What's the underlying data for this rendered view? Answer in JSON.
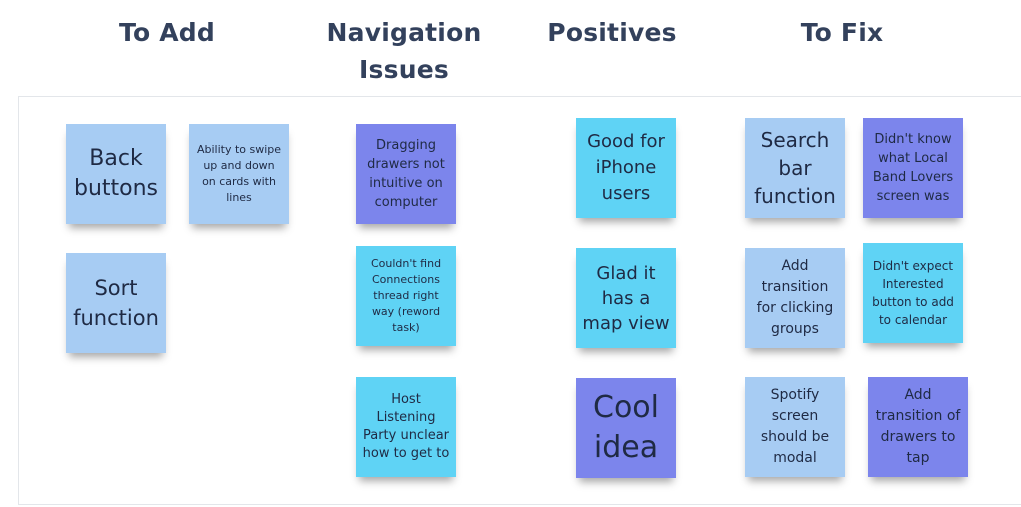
{
  "columns": {
    "to_add": "To Add",
    "navigation_issues": "Navigation\nIssues",
    "positives": "Positives",
    "to_fix": "To Fix"
  },
  "notes": {
    "back_buttons": "Back buttons",
    "swipe": "Ability to swipe up and down on cards with lines",
    "sort_function": "Sort function",
    "dragging_drawers": "Dragging drawers not intuitive on computer",
    "connections_thread": "Couldn't find Connections thread right way (reword task)",
    "host_listening": "Host Listening Party unclear how to get to",
    "good_for_iphone": "Good for iPhone users",
    "map_view": "Glad it has a map view",
    "cool_idea": "Cool idea",
    "search_bar": "Search bar function",
    "local_band_lovers": "Didn't know what Local Band Lovers screen was",
    "add_transition_groups": "Add transition for clicking groups",
    "interested_button": "Didn't expect Interested button to add to calendar",
    "spotify_modal": "Spotify screen should be modal",
    "transition_drawers": "Add transition of drawers to tap"
  },
  "colors": {
    "light_blue": "#a7ccf3",
    "cyan": "#5fd3f5",
    "periwinkle": "#7c85ec",
    "heading": "#33415c"
  }
}
